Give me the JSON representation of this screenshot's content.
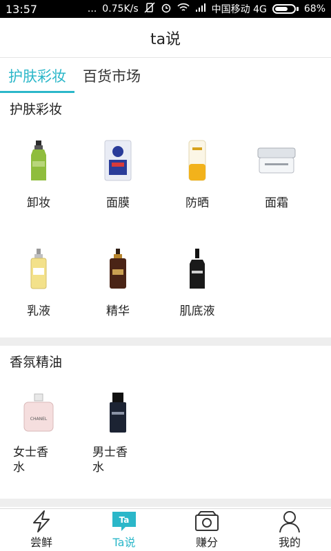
{
  "status_bar": {
    "time": "13:57",
    "dots": "...",
    "speed": "0.75K/s",
    "carrier": "中国移动 4G",
    "battery": "68%",
    "battery_level": 0.68
  },
  "header": {
    "title": "ta说"
  },
  "tabs": [
    {
      "label": "护肤彩妆",
      "active": true
    },
    {
      "label": "百货市场",
      "active": false
    }
  ],
  "sections": [
    {
      "title": "护肤彩妆",
      "items": [
        {
          "label": "卸妆",
          "icon": "makeup-remover-bottle-icon"
        },
        {
          "label": "面膜",
          "icon": "face-mask-pack-icon"
        },
        {
          "label": "防晒",
          "icon": "sunscreen-tube-icon"
        },
        {
          "label": "面霜",
          "icon": "face-cream-jar-icon"
        },
        {
          "label": "乳液",
          "icon": "lotion-bottle-icon"
        },
        {
          "label": "精华",
          "icon": "serum-dropper-bottle-icon"
        },
        {
          "label": "肌底液",
          "icon": "essence-bottle-icon"
        }
      ]
    },
    {
      "title": "香氛精油",
      "items": [
        {
          "label": "女士香水",
          "icon": "womens-perfume-icon",
          "brand_text": "CHANEL"
        },
        {
          "label": "男士香水",
          "icon": "mens-perfume-icon"
        }
      ]
    }
  ],
  "bottom_nav": [
    {
      "label": "尝鲜",
      "icon": "lightning-icon"
    },
    {
      "label": "Ta说",
      "icon": "ta-chat-bubble-icon",
      "badge": "Ta",
      "active": true
    },
    {
      "label": "赚分",
      "icon": "camera-money-icon"
    },
    {
      "label": "我的",
      "icon": "user-profile-icon"
    }
  ],
  "colors": {
    "accent": "#2bb7c9",
    "divider": "#eeeeee",
    "status_bar": "#000000"
  }
}
